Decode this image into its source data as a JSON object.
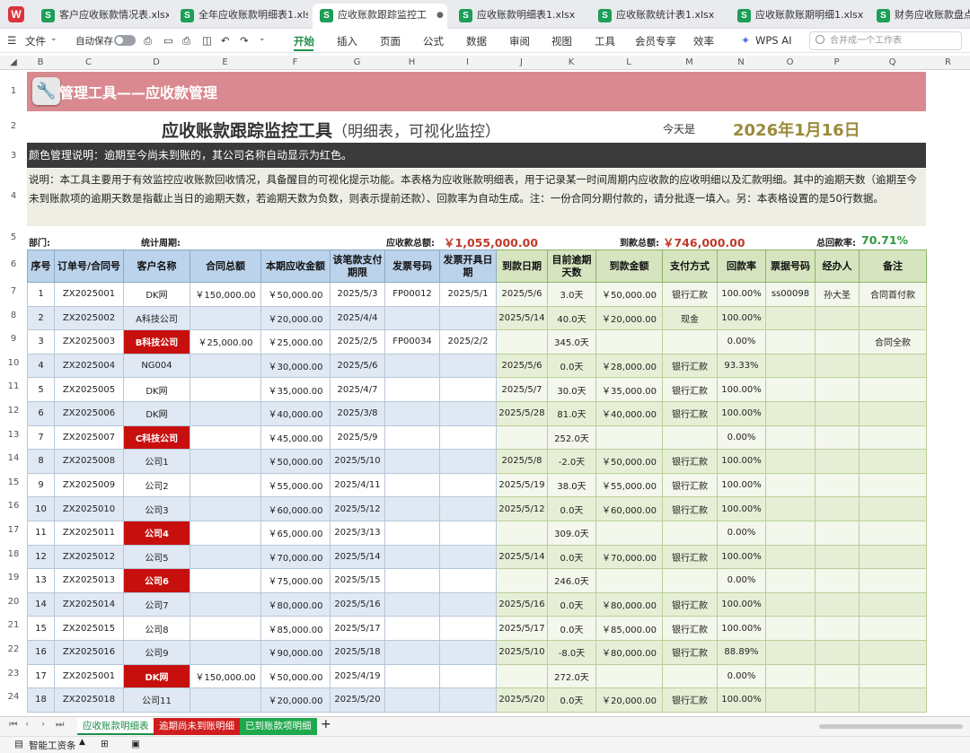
{
  "tabs": [
    {
      "label": "客户应收账款情况表.xlsx"
    },
    {
      "label": "全年应收账款明细表1.xlsx"
    },
    {
      "label": "应收账款跟踪监控工"
    },
    {
      "label": "应收账款明细表1.xlsx"
    },
    {
      "label": "应收账款统计表1.xlsx"
    },
    {
      "label": "应收账款账期明细1.xlsx"
    },
    {
      "label": "财务应收账款盘点明"
    }
  ],
  "menu": {
    "file": "文件",
    "autosave": "自动保存",
    "items": [
      "开始",
      "插入",
      "页面",
      "公式",
      "数据",
      "审阅",
      "视图",
      "工具",
      "会员专享",
      "效率"
    ],
    "wps_ai": "WPS AI",
    "search_placeholder": "合并成一个工作表"
  },
  "columns": [
    "A",
    "B",
    "C",
    "D",
    "E",
    "F",
    "G",
    "H",
    "I",
    "J",
    "K",
    "L",
    "M",
    "N",
    "O",
    "P",
    "Q",
    "R"
  ],
  "rows": [
    "1",
    "2",
    "3",
    "4",
    "5",
    "6",
    "7",
    "8",
    "9",
    "10",
    "11",
    "12",
    "13",
    "14",
    "15",
    "16",
    "17",
    "18",
    "19",
    "20",
    "21",
    "22",
    "23",
    "24"
  ],
  "banner": {
    "title": "管理工具——应收款管理"
  },
  "header": {
    "title": "应收账款跟踪监控工具",
    "subtitle": "（明细表，可视化监控）",
    "today_label": "今天是",
    "today_date": "2026年1月16日"
  },
  "color_note": "颜色管理说明：逾期至今尚未到账的，其公司名称自动显示为红色。",
  "description": "说明：本工具主要用于有效监控应收账款回收情况，具备醒目的可视化提示功能。本表格为应收账款明细表，用于记录某一时间周期内应收款的应收明细以及汇款明细。其中的逾期天数（逾期至今未到账款项的逾期天数是指截止当日的逾期天数，若逾期天数为负数，则表示提前还款）、回款率为自动生成。注：一份合同分期付款的，请分批逐一填入。另：本表格设置的是50行数据。",
  "stats": {
    "dept_label": "部门:",
    "period_label": "统计周期:",
    "receivable_label": "应收款总额:",
    "receivable_value": "￥1,055,000.00",
    "received_label": "到款总额:",
    "received_value": "￥746,000.00",
    "rate_label": "总回款率:",
    "rate_value": "70.71%"
  },
  "table": {
    "headers": [
      "序号",
      "订单号/合同号",
      "客户名称",
      "合同总额",
      "本期应收金额",
      "该笔款支付期限",
      "发票号码",
      "发票开具日期",
      "到款日期",
      "目前逾期天数",
      "到款金额",
      "支付方式",
      "回款率",
      "票据号码",
      "经办人",
      "备注"
    ],
    "rows": [
      [
        "1",
        "ZX2025001",
        "DK网",
        "￥150,000.00",
        "￥50,000.00",
        "2025/5/3",
        "FP00012",
        "2025/5/1",
        "2025/5/6",
        "3.0天",
        "￥50,000.00",
        "银行汇款",
        "100.00%",
        "ss00098",
        "孙大圣",
        "合同首付款"
      ],
      [
        "2",
        "ZX2025002",
        "A科技公司",
        "",
        "￥20,000.00",
        "2025/4/4",
        "",
        "",
        "2025/5/14",
        "40.0天",
        "￥20,000.00",
        "现金",
        "100.00%",
        "",
        "",
        ""
      ],
      [
        "3",
        "ZX2025003",
        "B科技公司",
        "￥25,000.00",
        "￥25,000.00",
        "2025/2/5",
        "FP00034",
        "2025/2/2",
        "",
        "345.0天",
        "",
        "",
        "0.00%",
        "",
        "",
        "合同全款"
      ],
      [
        "4",
        "ZX2025004",
        "NG004",
        "",
        "￥30,000.00",
        "2025/5/6",
        "",
        "",
        "2025/5/6",
        "0.0天",
        "￥28,000.00",
        "银行汇款",
        "93.33%",
        "",
        "",
        ""
      ],
      [
        "5",
        "ZX2025005",
        "DK网",
        "",
        "￥35,000.00",
        "2025/4/7",
        "",
        "",
        "2025/5/7",
        "30.0天",
        "￥35,000.00",
        "银行汇款",
        "100.00%",
        "",
        "",
        ""
      ],
      [
        "6",
        "ZX2025006",
        "DK网",
        "",
        "￥40,000.00",
        "2025/3/8",
        "",
        "",
        "2025/5/28",
        "81.0天",
        "￥40,000.00",
        "银行汇款",
        "100.00%",
        "",
        "",
        ""
      ],
      [
        "7",
        "ZX2025007",
        "C科技公司",
        "",
        "￥45,000.00",
        "2025/5/9",
        "",
        "",
        "",
        "252.0天",
        "",
        "",
        "0.00%",
        "",
        "",
        ""
      ],
      [
        "8",
        "ZX2025008",
        "公司1",
        "",
        "￥50,000.00",
        "2025/5/10",
        "",
        "",
        "2025/5/8",
        "-2.0天",
        "￥50,000.00",
        "银行汇款",
        "100.00%",
        "",
        "",
        ""
      ],
      [
        "9",
        "ZX2025009",
        "公司2",
        "",
        "￥55,000.00",
        "2025/4/11",
        "",
        "",
        "2025/5/19",
        "38.0天",
        "￥55,000.00",
        "银行汇款",
        "100.00%",
        "",
        "",
        ""
      ],
      [
        "10",
        "ZX2025010",
        "公司3",
        "",
        "￥60,000.00",
        "2025/5/12",
        "",
        "",
        "2025/5/12",
        "0.0天",
        "￥60,000.00",
        "银行汇款",
        "100.00%",
        "",
        "",
        ""
      ],
      [
        "11",
        "ZX2025011",
        "公司4",
        "",
        "￥65,000.00",
        "2025/3/13",
        "",
        "",
        "",
        "309.0天",
        "",
        "",
        "0.00%",
        "",
        "",
        ""
      ],
      [
        "12",
        "ZX2025012",
        "公司5",
        "",
        "￥70,000.00",
        "2025/5/14",
        "",
        "",
        "2025/5/14",
        "0.0天",
        "￥70,000.00",
        "银行汇款",
        "100.00%",
        "",
        "",
        ""
      ],
      [
        "13",
        "ZX2025013",
        "公司6",
        "",
        "￥75,000.00",
        "2025/5/15",
        "",
        "",
        "",
        "246.0天",
        "",
        "",
        "0.00%",
        "",
        "",
        ""
      ],
      [
        "14",
        "ZX2025014",
        "公司7",
        "",
        "￥80,000.00",
        "2025/5/16",
        "",
        "",
        "2025/5/16",
        "0.0天",
        "￥80,000.00",
        "银行汇款",
        "100.00%",
        "",
        "",
        ""
      ],
      [
        "15",
        "ZX2025015",
        "公司8",
        "",
        "￥85,000.00",
        "2025/5/17",
        "",
        "",
        "2025/5/17",
        "0.0天",
        "￥85,000.00",
        "银行汇款",
        "100.00%",
        "",
        "",
        ""
      ],
      [
        "16",
        "ZX2025016",
        "公司9",
        "",
        "￥90,000.00",
        "2025/5/18",
        "",
        "",
        "2025/5/10",
        "-8.0天",
        "￥80,000.00",
        "银行汇款",
        "88.89%",
        "",
        "",
        ""
      ],
      [
        "17",
        "ZX2025001",
        "DK网",
        "￥150,000.00",
        "￥50,000.00",
        "2025/4/19",
        "",
        "",
        "",
        "272.0天",
        "",
        "",
        "0.00%",
        "",
        "",
        ""
      ],
      [
        "18",
        "ZX2025018",
        "公司11",
        "",
        "￥20,000.00",
        "2025/5/20",
        "",
        "",
        "2025/5/20",
        "0.0天",
        "￥20,000.00",
        "银行汇款",
        "100.00%",
        "",
        "",
        ""
      ]
    ],
    "red_rows": [
      2,
      6,
      10,
      12,
      16
    ]
  },
  "sheet_tabs": [
    "应收账款明细表",
    "逾期尚未到账明细",
    "已到账款项明细"
  ],
  "status": {
    "left": "智能工资条"
  },
  "colors": {
    "banner": "#d9898f",
    "overdue_red": "#c7100d",
    "header_blue": "#bcd3ec",
    "header_green": "#d6e5bf",
    "accent_green": "#1d8d48"
  }
}
